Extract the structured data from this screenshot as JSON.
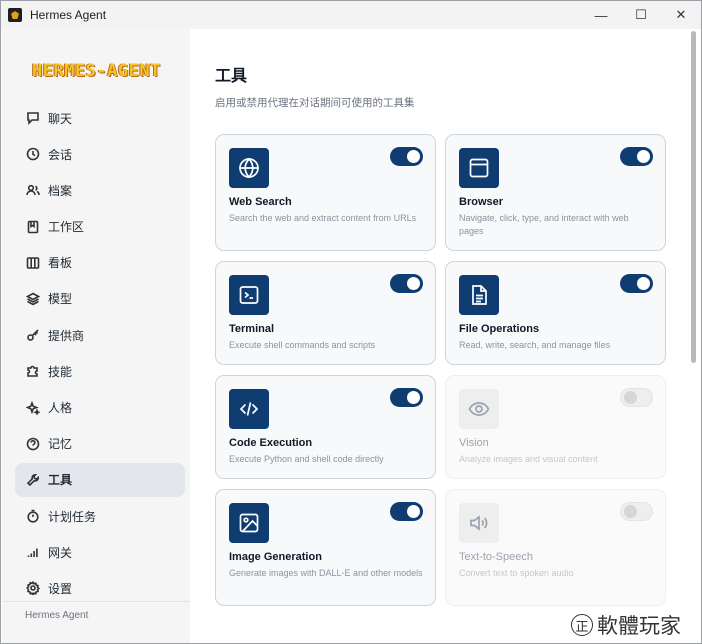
{
  "window": {
    "title": "Hermes Agent",
    "controls": {
      "minimize": "—",
      "maximize": "☐",
      "close": "✕"
    }
  },
  "sidebar": {
    "logo": "HERMES-AGENT",
    "items": [
      {
        "label": "聊天",
        "icon": "chat-icon",
        "active": false
      },
      {
        "label": "会话",
        "icon": "clock-icon",
        "active": false
      },
      {
        "label": "档案",
        "icon": "users-icon",
        "active": false
      },
      {
        "label": "工作区",
        "icon": "bookmark-icon",
        "active": false
      },
      {
        "label": "看板",
        "icon": "board-icon",
        "active": false
      },
      {
        "label": "模型",
        "icon": "layers-icon",
        "active": false
      },
      {
        "label": "提供商",
        "icon": "key-icon",
        "active": false
      },
      {
        "label": "技能",
        "icon": "puzzle-icon",
        "active": false
      },
      {
        "label": "人格",
        "icon": "sparkle-icon",
        "active": false
      },
      {
        "label": "记忆",
        "icon": "memory-icon",
        "active": false
      },
      {
        "label": "工具",
        "icon": "wrench-icon",
        "active": true
      },
      {
        "label": "计划任务",
        "icon": "timer-icon",
        "active": false
      },
      {
        "label": "网关",
        "icon": "signal-icon",
        "active": false
      },
      {
        "label": "设置",
        "icon": "gear-icon",
        "active": false
      }
    ],
    "footer": "Hermes Agent"
  },
  "main": {
    "title": "工具",
    "subtitle": "启用或禁用代理在对话期间可使用的工具集",
    "tools": [
      {
        "name": "Web Search",
        "description": "Search the web and extract content from URLs",
        "enabled": true,
        "icon": "globe-icon"
      },
      {
        "name": "Browser",
        "description": "Navigate, click, type, and interact with web pages",
        "enabled": true,
        "icon": "browser-window-icon"
      },
      {
        "name": "Terminal",
        "description": "Execute shell commands and scripts",
        "enabled": true,
        "icon": "terminal-icon"
      },
      {
        "name": "File Operations",
        "description": "Read, write, search, and manage files",
        "enabled": true,
        "icon": "file-icon"
      },
      {
        "name": "Code Execution",
        "description": "Execute Python and shell code directly",
        "enabled": true,
        "icon": "code-icon"
      },
      {
        "name": "Vision",
        "description": "Analyze images and visual content",
        "enabled": false,
        "icon": "eye-icon"
      },
      {
        "name": "Image Generation",
        "description": "Generate images with DALL-E and other models",
        "enabled": true,
        "icon": "image-icon"
      },
      {
        "name": "Text-to-Speech",
        "description": "Convert text to spoken audio",
        "enabled": false,
        "icon": "speaker-icon"
      }
    ]
  },
  "watermark": {
    "mark": "正",
    "text": "軟體玩家"
  },
  "colors": {
    "accent": "#0f3d72",
    "logo": "#f2c524"
  }
}
